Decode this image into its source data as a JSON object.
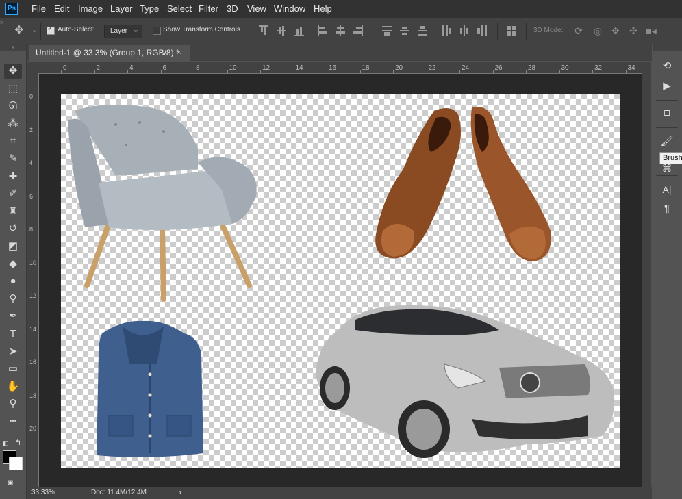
{
  "app": {
    "logo": "Ps"
  },
  "menu": [
    "File",
    "Edit",
    "Image",
    "Layer",
    "Type",
    "Select",
    "Filter",
    "3D",
    "View",
    "Window",
    "Help"
  ],
  "options": {
    "auto_select_label": "Auto-Select:",
    "auto_select_checked": true,
    "target_value": "Layer",
    "transform_label": "Show Transform Controls",
    "transform_checked": false,
    "mode_3d_label": "3D Mode:"
  },
  "document": {
    "tab_title": "Untitled-1 @ 33.3% (Group 1, RGB/8) *",
    "close_glyph": "×"
  },
  "ruler_top": [
    "0",
    "2",
    "4",
    "6",
    "8",
    "10",
    "12",
    "14",
    "16",
    "18",
    "20",
    "22",
    "24",
    "26",
    "28",
    "30",
    "32",
    "34"
  ],
  "ruler_left": [
    "0",
    "2",
    "4",
    "6",
    "8",
    "10",
    "12",
    "14",
    "16",
    "18",
    "20"
  ],
  "status": {
    "zoom": "33.33%",
    "doc_info": "Doc: 11.4M/12.4M",
    "arrow": "›"
  },
  "tooltip": "Brush",
  "tools": [
    {
      "icon": "move-tool-icon",
      "glyph": "✥"
    },
    {
      "icon": "marquee-tool-icon",
      "glyph": "⬚"
    },
    {
      "icon": "lasso-tool-icon",
      "glyph": "ᘏ"
    },
    {
      "icon": "magic-wand-tool-icon",
      "glyph": "⁂"
    },
    {
      "icon": "crop-tool-icon",
      "glyph": "⌗"
    },
    {
      "icon": "eyedropper-tool-icon",
      "glyph": "✎"
    },
    {
      "icon": "healing-brush-tool-icon",
      "glyph": "✚"
    },
    {
      "icon": "brush-tool-icon",
      "glyph": "✐"
    },
    {
      "icon": "clone-stamp-tool-icon",
      "glyph": "♜"
    },
    {
      "icon": "history-brush-tool-icon",
      "glyph": "↺"
    },
    {
      "icon": "eraser-tool-icon",
      "glyph": "◩"
    },
    {
      "icon": "paint-bucket-tool-icon",
      "glyph": "◆"
    },
    {
      "icon": "blur-tool-icon",
      "glyph": "●"
    },
    {
      "icon": "dodge-tool-icon",
      "glyph": "⚲"
    },
    {
      "icon": "pen-tool-icon",
      "glyph": "✒"
    },
    {
      "icon": "type-tool-icon",
      "glyph": "T"
    },
    {
      "icon": "path-selection-tool-icon",
      "glyph": "➤"
    },
    {
      "icon": "rectangle-tool-icon",
      "glyph": "▭"
    },
    {
      "icon": "hand-tool-icon",
      "glyph": "✋"
    },
    {
      "icon": "zoom-tool-icon",
      "glyph": "⚲"
    },
    {
      "icon": "more-tools-icon",
      "glyph": "•••"
    }
  ],
  "panel_buttons": [
    {
      "icon": "history-panel-icon",
      "glyph": "⟲"
    },
    {
      "icon": "actions-panel-icon",
      "glyph": "▶"
    },
    {
      "icon": "3d-panel-icon",
      "glyph": "⧈"
    },
    {
      "icon": "brush-settings-panel-icon",
      "glyph": "🖌"
    },
    {
      "icon": "clone-source-panel-icon",
      "glyph": "⌘"
    },
    {
      "icon": "character-panel-icon",
      "glyph": "A|"
    },
    {
      "icon": "paragraph-panel-icon",
      "glyph": "¶"
    }
  ]
}
